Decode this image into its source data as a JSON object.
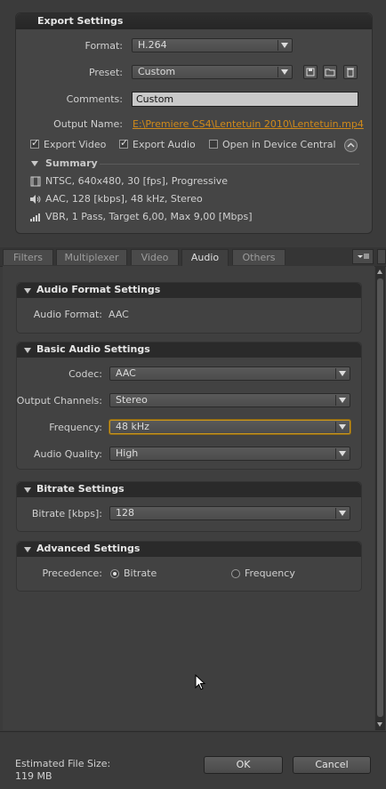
{
  "export_settings": {
    "title": "Export Settings",
    "format_label": "Format:",
    "format_value": "H.264",
    "preset_label": "Preset:",
    "preset_value": "Custom",
    "comments_label": "Comments:",
    "comments_value": "Custom",
    "output_name_label": "Output Name:",
    "output_name_value": "E:\\Premiere CS4\\Lentetuin 2010\\Lentetuin.mp4",
    "export_video_label": "Export Video",
    "export_video_checked": true,
    "export_audio_label": "Export Audio",
    "export_audio_checked": true,
    "device_central_label": "Open in Device Central",
    "device_central_checked": false
  },
  "summary": {
    "title": "Summary",
    "video_line": "NTSC, 640x480, 30 [fps], Progressive",
    "audio_line": "AAC, 128 [kbps], 48 kHz, Stereo",
    "bitrate_line": "VBR, 1 Pass, Target 6,00, Max 9,00 [Mbps]"
  },
  "tabs": [
    {
      "label": "Filters",
      "active": false
    },
    {
      "label": "Multiplexer",
      "active": false
    },
    {
      "label": "Video",
      "active": false
    },
    {
      "label": "Audio",
      "active": true
    },
    {
      "label": "Others",
      "active": false
    }
  ],
  "audio_format": {
    "title": "Audio Format Settings",
    "format_label": "Audio Format:",
    "format_value": "AAC"
  },
  "basic_audio": {
    "title": "Basic Audio Settings",
    "codec_label": "Codec:",
    "codec_value": "AAC",
    "channels_label": "Output Channels:",
    "channels_value": "Stereo",
    "frequency_label": "Frequency:",
    "frequency_value": "48 kHz",
    "quality_label": "Audio Quality:",
    "quality_value": "High"
  },
  "bitrate": {
    "title": "Bitrate Settings",
    "label": "Bitrate [kbps]:",
    "value": "128"
  },
  "advanced": {
    "title": "Advanced Settings",
    "precedence_label": "Precedence:",
    "option_bitrate": "Bitrate",
    "option_frequency": "Frequency",
    "selected": "Bitrate"
  },
  "footer": {
    "estimated_label": "Estimated File Size:",
    "estimated_value": "119 MB",
    "ok_label": "OK",
    "cancel_label": "Cancel"
  },
  "colors": {
    "link": "#d08a1a",
    "focus_border": "#c8951e"
  },
  "icons": [
    "save-preset-icon",
    "import-preset-icon",
    "delete-preset-icon",
    "collapse-icon",
    "film-icon",
    "speaker-icon",
    "bitrate-icon",
    "panel-menu-icon",
    "mouse-cursor-icon"
  ]
}
